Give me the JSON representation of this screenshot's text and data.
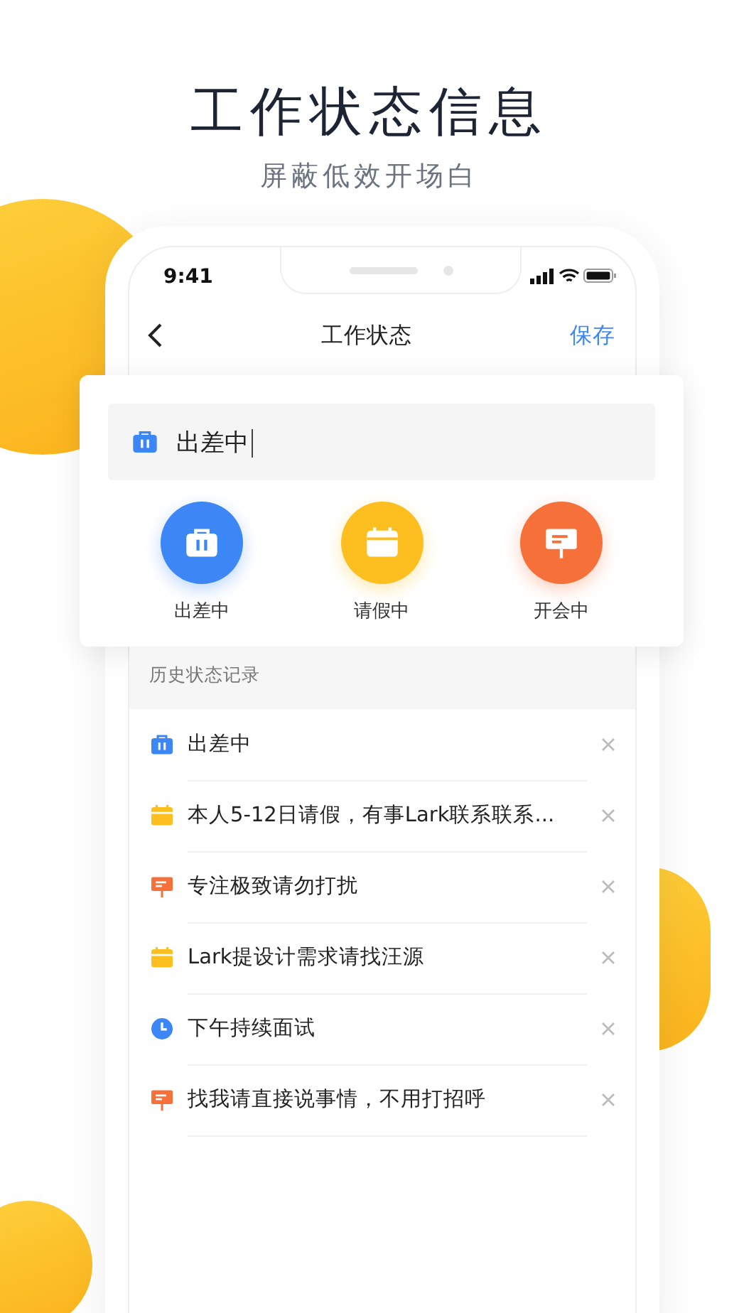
{
  "header": {
    "title": "工作状态信息",
    "subtitle": "屏蔽低效开场白"
  },
  "status_bar": {
    "time": "9:41"
  },
  "nav": {
    "title": "工作状态",
    "action": "保存"
  },
  "input": {
    "value": "出差中",
    "kind": "briefcase"
  },
  "options": [
    {
      "label": "出差中",
      "kind": "briefcase",
      "color": "#3d86f6"
    },
    {
      "label": "请假中",
      "kind": "calendar",
      "color": "#fcbf1f"
    },
    {
      "label": "开会中",
      "kind": "board",
      "color": "#f6703a"
    }
  ],
  "history": {
    "label": "历史状态记录",
    "items": [
      {
        "text": "出差中",
        "kind": "briefcase"
      },
      {
        "text": "本人5-12日请假，有事Lark联系联系...",
        "kind": "calendar"
      },
      {
        "text": "专注极致请勿打扰",
        "kind": "board"
      },
      {
        "text": "Lark提设计需求请找汪源",
        "kind": "calendar"
      },
      {
        "text": "下午持续面试",
        "kind": "clock"
      },
      {
        "text": "找我请直接说事情，不用打招呼",
        "kind": "board"
      }
    ]
  }
}
